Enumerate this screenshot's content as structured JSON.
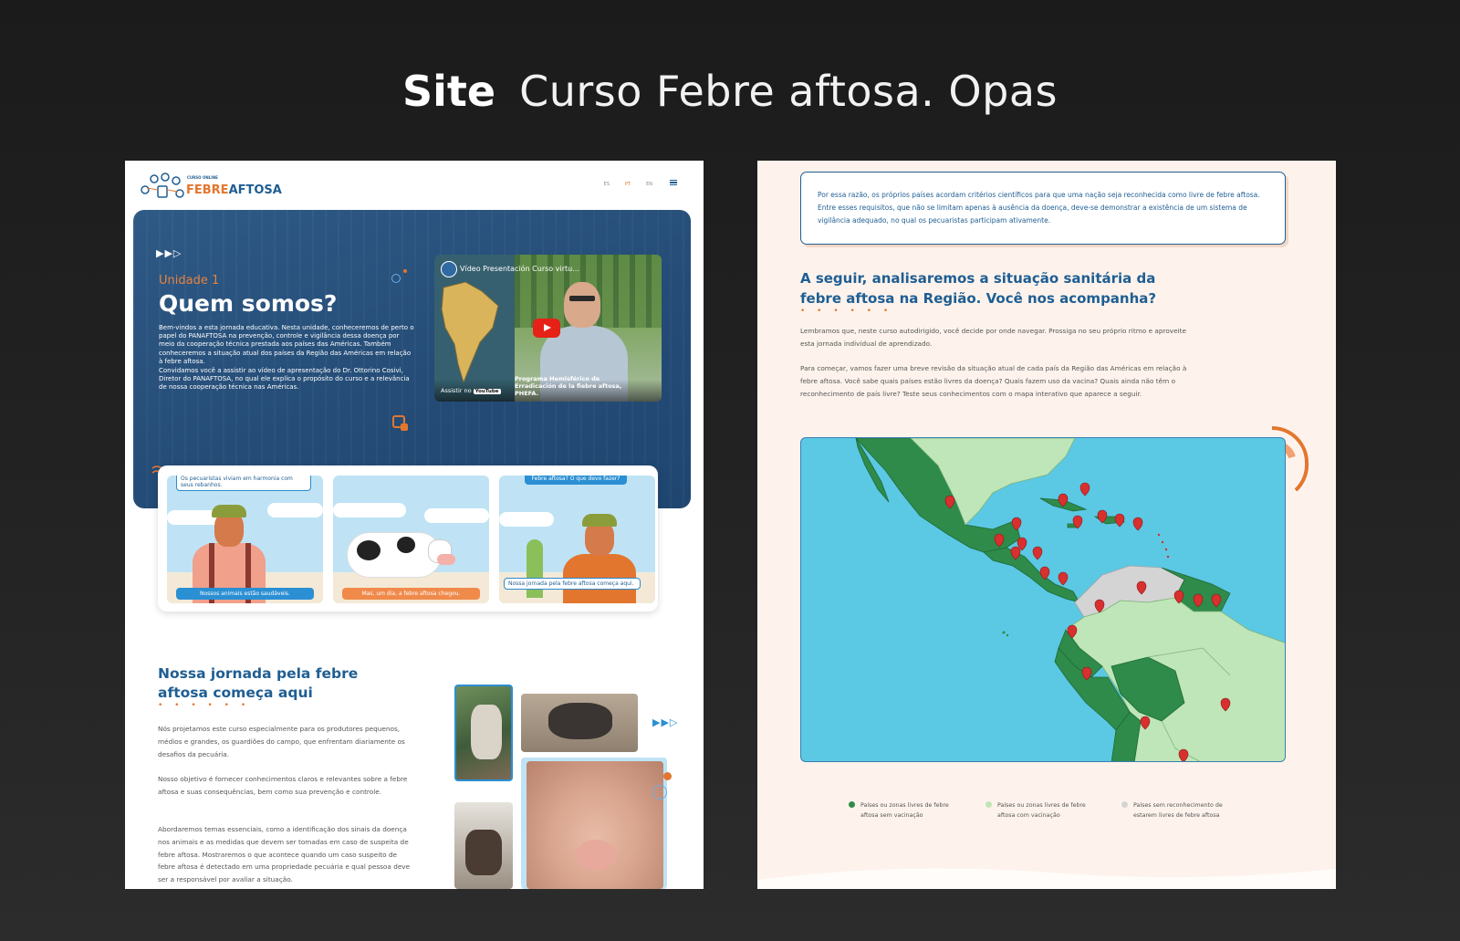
{
  "headline": {
    "strong": "Site",
    "light": "Curso Febre aftosa. Opas"
  },
  "left": {
    "logo": {
      "small": "CURSO ONLINE",
      "part1": "FEBRE",
      "part2": "AFTOSA"
    },
    "langs": [
      "ES",
      "PT",
      "EN"
    ],
    "active_lang": "PT",
    "hero": {
      "arrows": "▶▶▷",
      "unit": "Unidade 1",
      "title": "Quem somos?",
      "p1": "Bem-vindos a esta jornada educativa. Nesta unidade, conheceremos de perto o papel do PANAFTOSA na prevenção, controle e vigilância dessa doença por meio da cooperação técnica prestada aos países das Américas. Também conheceremos a situação atual dos países da Região das Américas em relação à febre aftosa.",
      "p2": "Convidamos você a assistir ao vídeo de apresentação do Dr. Ottorino Cosivi, Diretor do PANAFTOSA, no qual ele explica o propósito do curso e a relevância de nossa cooperação técnica nas Américas."
    },
    "video": {
      "title": "Vídeo Presentación Curso virtu...",
      "watch_on": "Assistir no",
      "youtube": "YouTube",
      "caption": "Programa Hemisférico de Erradicación de la fiebre aftosa, PHEFA."
    },
    "comics": [
      {
        "bubble": "Os pecuaristas viviam em harmonia com seus rebanhos.",
        "caption": "Nossos animais estão saudáveis."
      },
      {
        "bubble": "",
        "caption": "Mas, um dia, a febre aftosa chegou."
      },
      {
        "bubble": "Febre aftosa? O que devo fazer?",
        "caption": "Nossa jornada pela febre aftosa começa aqui."
      }
    ],
    "section": {
      "title": "Nossa jornada pela febre aftosa começa aqui",
      "dots": "• • • • • •",
      "p1": "Nós projetamos este curso especialmente para os produtores pequenos, médios e grandes, os guardiões do campo, que enfrentam diariamente os desafios da pecuária.",
      "p2": "Nosso objetivo é fornecer conhecimentos claros e relevantes sobre a febre aftosa e suas consequências, bem como sua prevenção e controle.",
      "p3": "Abordaremos temas essenciais, como a identificação dos sinais da doença nos animais e as medidas que devem ser tomadas em caso de suspeita de febre aftosa. Mostraremos o que acontece quando um caso suspeito de febre aftosa é detectado em uma propriedade pecuária e qual pessoa deve ser a responsável por avaliar a situação.",
      "arrows": "▶▶▷"
    }
  },
  "right": {
    "quote": "Por essa razão, os próprios países acordam critérios científicos para que uma nação seja reconhecida como livre de febre aftosa. Entre esses requisitos, que não se limitam apenas à ausência da doença, deve-se demonstrar a existência de um sistema de vigilância adequado, no qual os pecuaristas participam ativamente.",
    "title": "A seguir, analisaremos a situação sanitária da febre aftosa na Região. Você nos acompanha?",
    "dots": "• • • • • •",
    "p1": "Lembramos que, neste curso autodirigido, você decide por onde navegar. Prossiga no seu próprio ritmo e aproveite esta jornada individual de aprendizado.",
    "p2": "Para começar, vamos fazer uma breve revisão da situação atual de cada país da Região das Américas em relação à febre aftosa. Você sabe quais países estão livres da doença? Quais fazem uso da vacina? Quais ainda não têm o reconhecimento de país livre? Teste seus conhecimentos com o mapa interativo que aparece a seguir.",
    "legend": [
      {
        "text": "Países ou zonas livres de febre aftosa sem vacinação",
        "color": "#2e8b4a"
      },
      {
        "text": "Países ou zonas livres de febre aftosa com vacinação",
        "color": "#bfe6b8"
      },
      {
        "text": "Países sem reconhecimento de estarem livres de febre aftosa",
        "color": "#d4d4d4"
      }
    ]
  },
  "colors": {
    "brand_blue": "#1f5e93",
    "brand_orange": "#e3762f",
    "ocean": "#5bc8e4",
    "free_no_vacc": "#2e8b4a",
    "free_vacc": "#bfe6b8",
    "not_free": "#d4d4d4",
    "pin": "#d8302f"
  }
}
